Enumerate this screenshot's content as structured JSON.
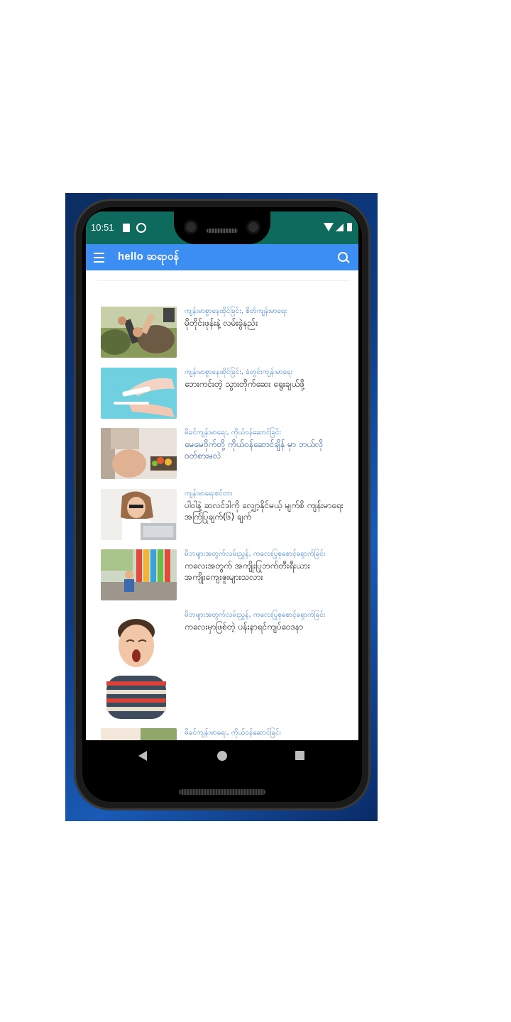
{
  "status_bar": {
    "time": "10:51"
  },
  "app_bar": {
    "logo_text": "hello ဆရာဝန်"
  },
  "articles": [
    {
      "category": "ကျန်းမာစွာနေထိုင်ခြင်း, စိတ်ကျန်းမာရေး",
      "title": "မိုတိုင်းဖုန်းနဲ့ လမ်းခွဲနည်း",
      "title_color": "#111111",
      "thumb": "people-hands-with-phones"
    },
    {
      "category": "ကျန်းမာစွာနေထိုင်ခြင်း, ခံတွင်းကျန်းမာရေး",
      "title": "ဘေးကင်းတဲ့ သွားတိုက်ဆေး ရွေးချယ်ဖို့",
      "title_color": "#111111",
      "thumb": "toothpaste-on-brush"
    },
    {
      "category": "မိခင်ကျန်းမာရေး, ကိုယ်ဝန်ဆောင်ခြင်း",
      "title": "မေမေဗိုက်တို့ ကိုယ်ဝန်ဆောင်ချိန် မှာ ဘယ်လို ဝတ်စားမလဲ",
      "title_color": "#1f4f96",
      "thumb": "pregnant-woman"
    },
    {
      "category": "ကျန်းမာရေးစင်တာ",
      "title": "ပါဝါနဲ့ ဆလင်ဒါကို လျှော့နိုင်မယ့် မျက်စိ ကျန်းမာရေး အကြံပြုချက်(၆) ချက်",
      "title_color": "#111111",
      "thumb": "woman-at-laptop"
    },
    {
      "category": "မိဘများအတွက်လမ်းညွှန်, ကလေးပြုစုစောင့်ရှောက်ခြင်း",
      "title": "ကလေးအတွက် အကျိုးပြုဘက်တီးရီးယား အကျိုးကျေးဇူးများသလား",
      "title_color": "#111111",
      "thumb": "child-outdoors"
    },
    {
      "category": "မိဘများအတွက်လမ်းညွှန်, ကလေးပြုစုစောင့်ရှောက်ခြင်း",
      "title": "ကလေးမှာဖြစ်တဲ့ ပန်းနာရင်ကျပ်ဝေဒနာ",
      "title_color": "#111111",
      "thumb": "boy-yawning"
    },
    {
      "category": "မိခင်ကျန်းမာရေး, ကိုယ်ဝန်ဆောင်ခြင်း",
      "title": "",
      "title_color": "#111111",
      "thumb": "mother-photo"
    }
  ],
  "colors": {
    "app_bar": "#3d8ef2",
    "status_bar": "#0e6a5c",
    "category_text": "#3b7fdc",
    "backdrop": "#0d3b82"
  }
}
